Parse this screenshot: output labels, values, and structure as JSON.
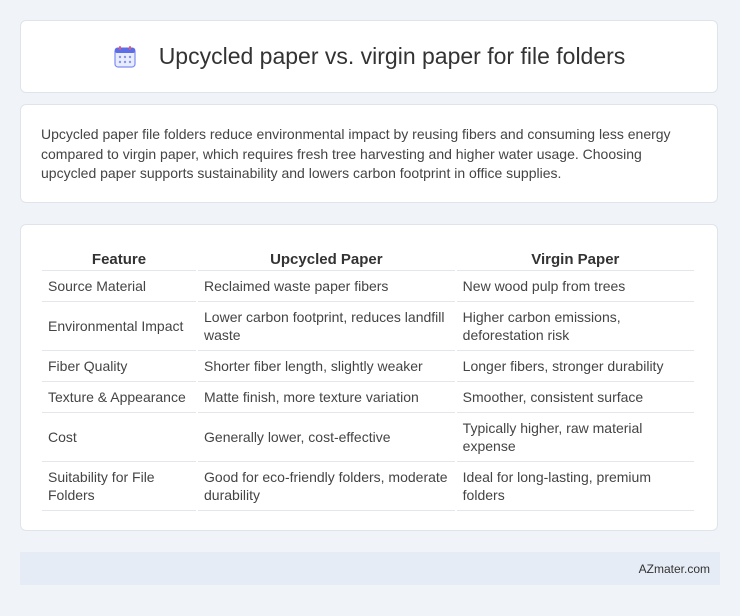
{
  "header": {
    "title": "Upcycled paper vs. virgin paper for file folders",
    "icon": "calendar-icon"
  },
  "description": "Upcycled paper file folders reduce environmental impact by reusing fibers and consuming less energy compared to virgin paper, which requires fresh tree harvesting and higher water usage. Choosing upcycled paper supports sustainability and lowers carbon footprint in office supplies.",
  "table": {
    "columns": [
      "Feature",
      "Upcycled Paper",
      "Virgin Paper"
    ],
    "rows": [
      [
        "Source Material",
        "Reclaimed waste paper fibers",
        "New wood pulp from trees"
      ],
      [
        "Environmental Impact",
        "Lower carbon footprint, reduces landfill waste",
        "Higher carbon emissions, deforestation risk"
      ],
      [
        "Fiber Quality",
        "Shorter fiber length, slightly weaker",
        "Longer fibers, stronger durability"
      ],
      [
        "Texture & Appearance",
        "Matte finish, more texture variation",
        "Smoother, consistent surface"
      ],
      [
        "Cost",
        "Generally lower, cost-effective",
        "Typically higher, raw material expense"
      ],
      [
        "Suitability for File Folders",
        "Good for eco-friendly folders, moderate durability",
        "Ideal for long-lasting, premium folders"
      ]
    ]
  },
  "footer": {
    "brand": "AZmater.com"
  }
}
